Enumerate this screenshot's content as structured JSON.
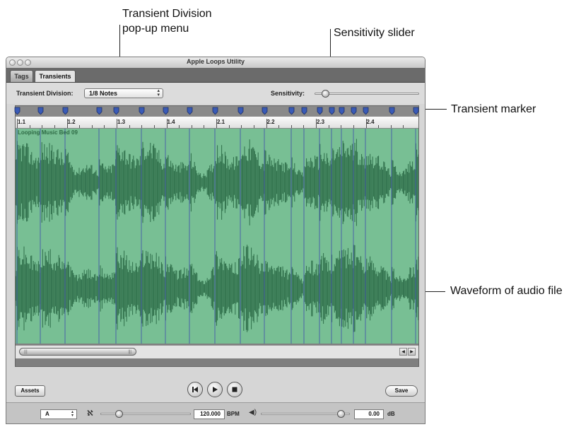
{
  "callouts": {
    "division_line1": "Transient Division",
    "division_line2": "pop-up menu",
    "sensitivity": "Sensitivity slider",
    "marker": "Transient marker",
    "waveform": "Waveform of audio file"
  },
  "window": {
    "title": "Apple Loops Utility",
    "tabs": [
      {
        "label": "Tags",
        "active": false
      },
      {
        "label": "Transients",
        "active": true
      }
    ]
  },
  "controls": {
    "division_label": "Transient Division:",
    "division_value": "1/8 Notes",
    "sensitivity_label": "Sensitivity:",
    "sensitivity_level": 0.1
  },
  "ruler": {
    "labels": [
      "1.1",
      "1.2",
      "1.3",
      "1.4",
      "2.1",
      "2.2",
      "2.3",
      "2.4"
    ]
  },
  "region": {
    "name": "Looping Music Bed 09"
  },
  "colors": {
    "waveform_bg": "#78bf94",
    "waveform": "#2f6f4a",
    "marker": "#3a5bb7"
  },
  "buttons": {
    "assets": "Assets",
    "save": "Save"
  },
  "bottom": {
    "key": "A",
    "tempo": "120.000",
    "tempo_unit": "BPM",
    "tempo_level": 0.2,
    "volume": "0.00",
    "volume_unit": "dB",
    "volume_level": 0.9
  },
  "icons": {
    "tuning_fork": "tuning-fork-icon",
    "speaker": "speaker-icon",
    "rewind": "go-to-start-icon",
    "play": "play-icon",
    "stop": "stop-icon"
  }
}
